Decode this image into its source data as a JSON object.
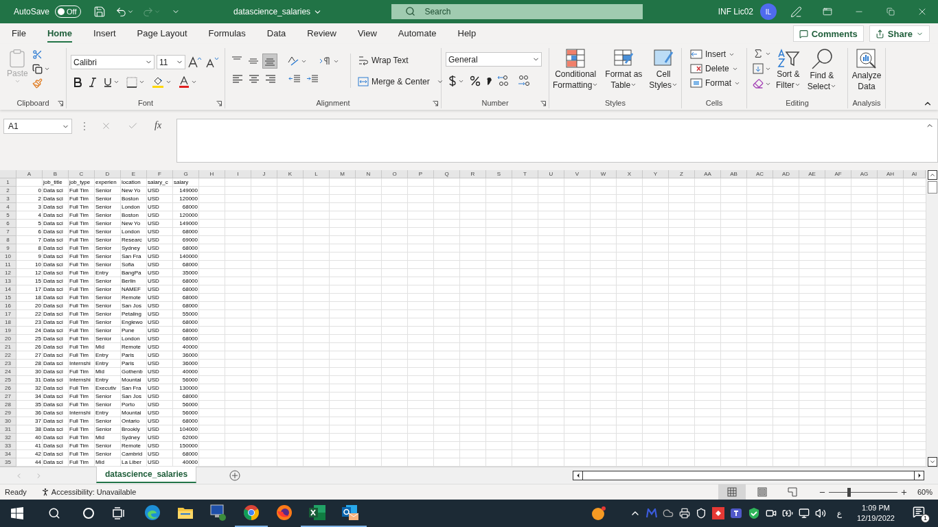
{
  "title_bar": {
    "autosave_label": "AutoSave",
    "autosave": {
      "label": "Off",
      "on": false
    },
    "redo": {
      "disabled": true
    },
    "file_name": "datascience_salaries",
    "search": {
      "placeholder": "Search"
    },
    "user_name": "INF Lic02",
    "avatar_initials": "IL"
  },
  "menu_tabs": [
    {
      "label": "File",
      "selected": false
    },
    {
      "label": "Home",
      "selected": true
    },
    {
      "label": "Insert",
      "selected": false
    },
    {
      "label": "Page Layout",
      "selected": false
    },
    {
      "label": "Formulas",
      "selected": false
    },
    {
      "label": "Data",
      "selected": false
    },
    {
      "label": "Review",
      "selected": false
    },
    {
      "label": "View",
      "selected": false
    },
    {
      "label": "Automate",
      "selected": false
    },
    {
      "label": "Help",
      "selected": false
    }
  ],
  "comments_button": "Comments",
  "share_button": "Share",
  "ribbon": {
    "clipboard": {
      "title": "Clipboard",
      "paste": {
        "label": "Paste",
        "disabled": true
      }
    },
    "font": {
      "title": "Font",
      "font_name": "Calibri",
      "font_size": "11"
    },
    "alignment": {
      "title": "Alignment",
      "vertical_align": [
        {
          "kind": "top",
          "selected": false
        },
        {
          "kind": "middle",
          "selected": false
        },
        {
          "kind": "bottom",
          "selected": true
        }
      ],
      "wrap_text": "Wrap Text",
      "merge": "Merge & Center"
    },
    "number": {
      "title": "Number",
      "format": "General"
    },
    "styles": {
      "title": "Styles",
      "buttons": [
        {
          "kind": "conditional",
          "lines": [
            "Conditional",
            "Formatting"
          ]
        },
        {
          "kind": "table",
          "lines": [
            "Format as",
            "Table"
          ]
        },
        {
          "kind": "cell",
          "lines": [
            "Cell",
            "Styles"
          ]
        }
      ]
    },
    "cells": {
      "title": "Cells",
      "buttons": [
        {
          "kind": "insert",
          "label": "Insert"
        },
        {
          "kind": "delete",
          "label": "Delete"
        },
        {
          "kind": "format",
          "label": "Format"
        }
      ]
    },
    "editing": {
      "title": "Editing",
      "buttons": [
        {
          "kind": "sort",
          "lines": [
            "Sort &",
            "Filter"
          ]
        },
        {
          "kind": "find",
          "lines": [
            "Find &",
            "Select"
          ]
        }
      ]
    },
    "analysis": {
      "title": "Analysis",
      "lines": [
        "Analyze",
        "Data"
      ]
    }
  },
  "formula_bar": {
    "name_box": "A1",
    "function_label": "fx"
  },
  "sheet": {
    "columns": [
      "A",
      "B",
      "C",
      "D",
      "E",
      "F",
      "G",
      "H",
      "I",
      "J",
      "K",
      "L",
      "M",
      "N",
      "O",
      "P",
      "Q",
      "R",
      "S",
      "T",
      "U",
      "V",
      "W",
      "X",
      "Y",
      "Z",
      "AA",
      "AB",
      "AC",
      "AD",
      "AE",
      "AF",
      "AG",
      "AH",
      "AI"
    ],
    "header_row": {
      "row": "1",
      "cells": [
        "job_title",
        "job_type",
        "experien",
        "location",
        "salary_c",
        "salary"
      ]
    },
    "rows": [
      {
        "row": "2",
        "cells": [
          "0",
          "Data sci",
          "Full Tim",
          "Senior",
          "New Yo",
          "USD",
          "149000"
        ]
      },
      {
        "row": "3",
        "cells": [
          "2",
          "Data sci",
          "Full Tim",
          "Senior",
          "Boston",
          "USD",
          "120000"
        ]
      },
      {
        "row": "4",
        "cells": [
          "3",
          "Data sci",
          "Full Tim",
          "Senior",
          "London",
          "USD",
          "68000"
        ]
      },
      {
        "row": "5",
        "cells": [
          "4",
          "Data sci",
          "Full Tim",
          "Senior",
          "Boston",
          "USD",
          "120000"
        ]
      },
      {
        "row": "6",
        "cells": [
          "5",
          "Data sci",
          "Full Tim",
          "Senior",
          "New Yo",
          "USD",
          "149000"
        ]
      },
      {
        "row": "7",
        "cells": [
          "6",
          "Data sci",
          "Full Tim",
          "Senior",
          "London",
          "USD",
          "68000"
        ]
      },
      {
        "row": "8",
        "cells": [
          "7",
          "Data sci",
          "Full Tim",
          "Senior",
          "Researc",
          "USD",
          "69000"
        ]
      },
      {
        "row": "9",
        "cells": [
          "8",
          "Data sci",
          "Full Tim",
          "Senior",
          "Sydney",
          "USD",
          "68000"
        ]
      },
      {
        "row": "10",
        "cells": [
          "9",
          "Data sci",
          "Full Tim",
          "Senior",
          "San Fra",
          "USD",
          "140000"
        ]
      },
      {
        "row": "11",
        "cells": [
          "10",
          "Data sci",
          "Full Tim",
          "Senior",
          "Sofia",
          "USD",
          "68000"
        ]
      },
      {
        "row": "12",
        "cells": [
          "12",
          "Data sci",
          "Full Tim",
          "Entry",
          "BangPa",
          "USD",
          "35000"
        ]
      },
      {
        "row": "13",
        "cells": [
          "15",
          "Data sci",
          "Full Tim",
          "Senior",
          "Berlin",
          "USD",
          "68000"
        ]
      },
      {
        "row": "14",
        "cells": [
          "17",
          "Data sci",
          "Full Tim",
          "Senior",
          "NAMEF",
          "USD",
          "68000"
        ]
      },
      {
        "row": "15",
        "cells": [
          "18",
          "Data sci",
          "Full Tim",
          "Senior",
          "Remote",
          "USD",
          "68000"
        ]
      },
      {
        "row": "16",
        "cells": [
          "20",
          "Data sci",
          "Full Tim",
          "Senior",
          "San Jos",
          "USD",
          "68000"
        ]
      },
      {
        "row": "17",
        "cells": [
          "22",
          "Data sci",
          "Full Tim",
          "Senior",
          "Petaling",
          "USD",
          "55000"
        ]
      },
      {
        "row": "18",
        "cells": [
          "23",
          "Data sci",
          "Full Tim",
          "Senior",
          "Englewo",
          "USD",
          "68000"
        ]
      },
      {
        "row": "19",
        "cells": [
          "24",
          "Data sci",
          "Full Tim",
          "Senior",
          "Pune",
          "USD",
          "68000"
        ]
      },
      {
        "row": "20",
        "cells": [
          "25",
          "Data sci",
          "Full Tim",
          "Senior",
          "London",
          "USD",
          "68000"
        ]
      },
      {
        "row": "21",
        "cells": [
          "26",
          "Data sci",
          "Full Tim",
          "Mid",
          "Remote",
          "USD",
          "40000"
        ]
      },
      {
        "row": "22",
        "cells": [
          "27",
          "Data sci",
          "Full Tim",
          "Entry",
          "Paris",
          "USD",
          "36000"
        ]
      },
      {
        "row": "23",
        "cells": [
          "28",
          "Data sci",
          "Internshi",
          "Entry",
          "Paris",
          "USD",
          "36000"
        ]
      },
      {
        "row": "24",
        "cells": [
          "30",
          "Data sci",
          "Full Tim",
          "Mid",
          "Gothenb",
          "USD",
          "40000"
        ]
      },
      {
        "row": "25",
        "cells": [
          "31",
          "Data sci",
          "Internshi",
          "Entry",
          "Mountai",
          "USD",
          "56000"
        ]
      },
      {
        "row": "26",
        "cells": [
          "32",
          "Data sci",
          "Full Tim",
          "Executiv",
          "San Fra",
          "USD",
          "130000"
        ]
      },
      {
        "row": "27",
        "cells": [
          "34",
          "Data sci",
          "Full Tim",
          "Senior",
          "San Jos",
          "USD",
          "68000"
        ]
      },
      {
        "row": "28",
        "cells": [
          "35",
          "Data sci",
          "Full Tim",
          "Senior",
          "Porto",
          "USD",
          "56000"
        ]
      },
      {
        "row": "29",
        "cells": [
          "36",
          "Data sci",
          "Internshi",
          "Entry",
          "Mountai",
          "USD",
          "56000"
        ]
      },
      {
        "row": "30",
        "cells": [
          "37",
          "Data sci",
          "Full Tim",
          "Senior",
          "Ontario",
          "USD",
          "68000"
        ]
      },
      {
        "row": "31",
        "cells": [
          "38",
          "Data sci",
          "Full Tim",
          "Senior",
          "Brookly",
          "USD",
          "104000"
        ]
      },
      {
        "row": "32",
        "cells": [
          "40",
          "Data sci",
          "Full Tim",
          "Mid",
          "Sydney",
          "USD",
          "62000"
        ]
      },
      {
        "row": "33",
        "cells": [
          "41",
          "Data sci",
          "Full Tim",
          "Senior",
          "Remote",
          "USD",
          "150000"
        ]
      },
      {
        "row": "34",
        "cells": [
          "42",
          "Data sci",
          "Full Tim",
          "Senior",
          "Cambrid",
          "USD",
          "68000"
        ]
      },
      {
        "row": "35",
        "cells": [
          "44",
          "Data sci",
          "Full Tim",
          "Mid",
          "La Liber",
          "USD",
          "40000"
        ]
      }
    ]
  },
  "sheet_tabs": [
    {
      "label": "datascience_salaries",
      "selected": true
    }
  ],
  "status_bar": {
    "status": "Ready",
    "accessibility": "Accessibility: Unavailable",
    "views": [
      {
        "kind": "normal",
        "selected": true
      },
      {
        "kind": "page_layout",
        "selected": false
      },
      {
        "kind": "page_break",
        "selected": false
      }
    ],
    "zoom": {
      "level": 0.29,
      "reading": "60%"
    }
  },
  "taskbar": {
    "apps": [
      {
        "kind": "edge",
        "open": false
      },
      {
        "kind": "folder",
        "open": false
      },
      {
        "kind": "remote",
        "open": false
      },
      {
        "kind": "chrome",
        "open": true
      },
      {
        "kind": "firefox",
        "open": false
      },
      {
        "kind": "excel",
        "open": true
      },
      {
        "kind": "outlook",
        "open": true
      }
    ],
    "language": "ع",
    "time": "1:09 PM",
    "date": "12/19/2022",
    "notification_count": "1"
  }
}
